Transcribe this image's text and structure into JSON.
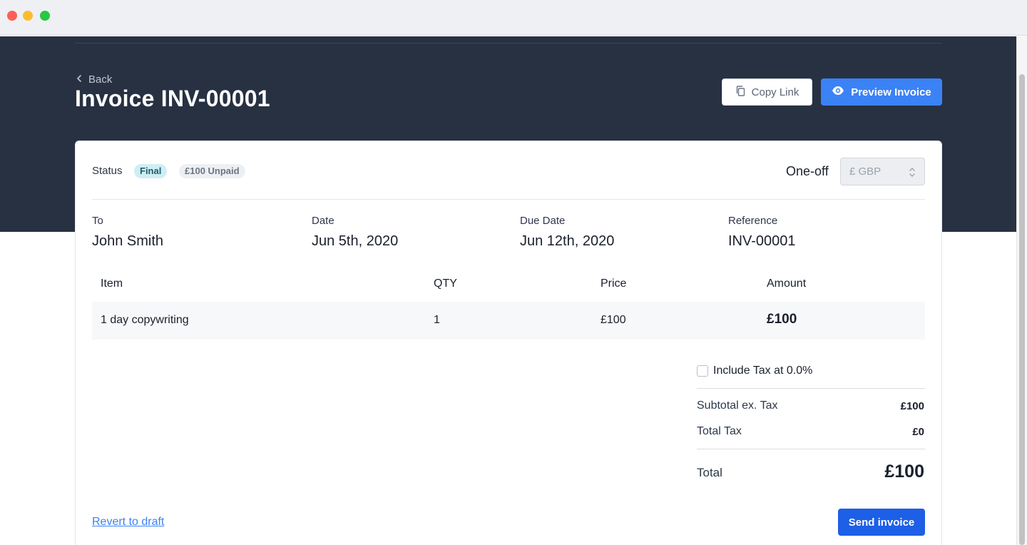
{
  "window": {
    "controls": [
      "close",
      "minimize",
      "zoom"
    ]
  },
  "header": {
    "back_label": "Back",
    "title": "Invoice INV-00001",
    "copy_link_label": "Copy Link",
    "preview_label": "Preview Invoice",
    "copy_icon": "copy-icon",
    "preview_icon": "eye-icon"
  },
  "status": {
    "label": "Status",
    "state_badge": "Final",
    "payment_badge": "£100 Unpaid"
  },
  "billing": {
    "type_label": "One-off",
    "currency_value": "£ GBP"
  },
  "meta": {
    "to_label": "To",
    "to_value": "John Smith",
    "date_label": "Date",
    "date_value": "Jun 5th, 2020",
    "due_label": "Due Date",
    "due_value": "Jun 12th, 2020",
    "reference_label": "Reference",
    "reference_value": "INV-00001"
  },
  "items": {
    "headers": [
      "Item",
      "QTY",
      "Price",
      "Amount"
    ],
    "rows": [
      {
        "item": "1 day copywriting",
        "qty": "1",
        "price": "£100",
        "amount": "£100"
      }
    ]
  },
  "summary": {
    "tax_checkbox_label": "Include Tax at 0.0%",
    "tax_checked": false,
    "subtotal_label": "Subtotal ex. Tax",
    "subtotal_value": "£100",
    "tax_label": "Total Tax",
    "tax_value": "£0",
    "total_label": "Total",
    "total_value": "£100"
  },
  "actions": {
    "revert_label": "Revert to draft",
    "send_label": "Send invoice"
  },
  "colors": {
    "header_bg": "#273142",
    "primary": "#3b82f6",
    "send_button": "#1d5fe6"
  }
}
